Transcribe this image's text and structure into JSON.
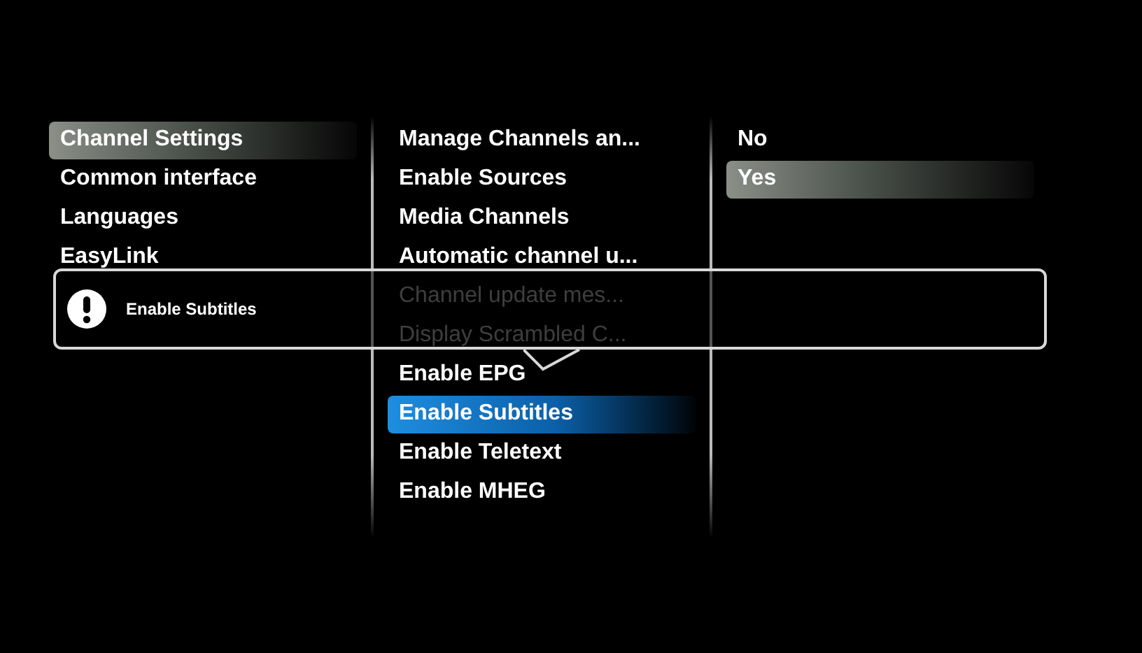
{
  "menu": {
    "columns": [
      {
        "focused": false,
        "items": [
          {
            "label": "Channel Settings",
            "selected": true,
            "dimmed": false
          },
          {
            "label": "Common interface",
            "selected": false,
            "dimmed": false
          },
          {
            "label": "Languages",
            "selected": false,
            "dimmed": false
          },
          {
            "label": "EasyLink",
            "selected": false,
            "dimmed": false
          }
        ]
      },
      {
        "focused": true,
        "items": [
          {
            "label": "Manage Channels an...",
            "selected": false,
            "dimmed": false
          },
          {
            "label": "Enable Sources",
            "selected": false,
            "dimmed": false
          },
          {
            "label": "Media Channels",
            "selected": false,
            "dimmed": false
          },
          {
            "label": "Automatic channel u...",
            "selected": false,
            "dimmed": false
          },
          {
            "label": "Channel update mes...",
            "selected": false,
            "dimmed": true
          },
          {
            "label": "Display Scrambled C...",
            "selected": false,
            "dimmed": true
          },
          {
            "label": "Enable EPG",
            "selected": false,
            "dimmed": false
          },
          {
            "label": "Enable Subtitles",
            "selected": true,
            "dimmed": false
          },
          {
            "label": "Enable Teletext",
            "selected": false,
            "dimmed": false
          },
          {
            "label": "Enable MHEG",
            "selected": false,
            "dimmed": false
          }
        ]
      },
      {
        "focused": false,
        "items": [
          {
            "label": "No",
            "selected": false,
            "dimmed": false
          },
          {
            "label": "Yes",
            "selected": true,
            "dimmed": false
          }
        ]
      }
    ]
  },
  "popup": {
    "message": "Enable Subtitles"
  }
}
